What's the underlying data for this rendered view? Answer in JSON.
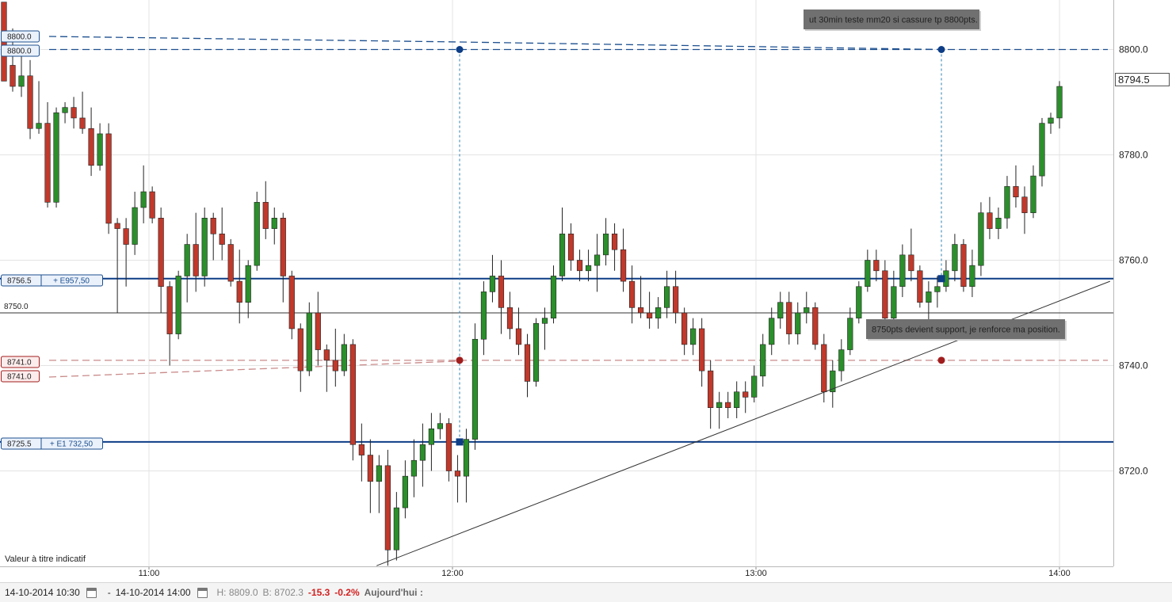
{
  "chart_data": {
    "type": "candlestick",
    "price_axis": {
      "ticks": [
        8720.0,
        8740.0,
        8760.0,
        8780.0,
        8800.0
      ],
      "tick_labels": [
        "8720.0",
        "8740.0",
        "8760.0",
        "8780.0",
        "8800.0"
      ],
      "ylim": [
        8696,
        8808
      ]
    },
    "time_axis": {
      "ticks": [
        "11:00",
        "12:00",
        "13:00",
        "14:00"
      ]
    },
    "grid": true,
    "last_price": "8794.5",
    "candles": [
      [
        8809,
        8808,
        8797,
        8794
      ],
      [
        8797,
        8804,
        8792,
        8793
      ],
      [
        8793,
        8799,
        8791,
        8795
      ],
      [
        8795,
        8798,
        8783,
        8785
      ],
      [
        8785,
        8794,
        8784,
        8786
      ],
      [
        8786,
        8790,
        8770,
        8771
      ],
      [
        8771,
        8789,
        8770,
        8788
      ],
      [
        8788,
        8790,
        8786,
        8789
      ],
      [
        8789,
        8791,
        8785,
        8787
      ],
      [
        8787,
        8792,
        8784,
        8785
      ],
      [
        8785,
        8789,
        8776,
        8778
      ],
      [
        8778,
        8786,
        8777,
        8784
      ],
      [
        8784,
        8786,
        8765,
        8767
      ],
      [
        8767,
        8768,
        8750,
        8766
      ],
      [
        8766,
        8768,
        8755,
        8763
      ],
      [
        8763,
        8773,
        8761,
        8770
      ],
      [
        8770,
        8778,
        8767,
        8773
      ],
      [
        8773,
        8774,
        8767,
        8768
      ],
      [
        8768,
        8770,
        8750,
        8755
      ],
      [
        8755,
        8756,
        8740,
        8746
      ],
      [
        8746,
        8758,
        8745,
        8757
      ],
      [
        8757,
        8765,
        8752,
        8763
      ],
      [
        8763,
        8769,
        8754,
        8757
      ],
      [
        8757,
        8770,
        8755,
        8768
      ],
      [
        8768,
        8769,
        8760,
        8765
      ],
      [
        8765,
        8770,
        8760,
        8763
      ],
      [
        8763,
        8764,
        8755,
        8756
      ],
      [
        8756,
        8762,
        8748,
        8752
      ],
      [
        8752,
        8760,
        8749,
        8759
      ],
      [
        8759,
        8773,
        8758,
        8771
      ],
      [
        8771,
        8775,
        8764,
        8766
      ],
      [
        8766,
        8770,
        8763,
        8768
      ],
      [
        8768,
        8769,
        8752,
        8757
      ],
      [
        8757,
        8758,
        8745,
        8747
      ],
      [
        8747,
        8748,
        8735,
        8739
      ],
      [
        8739,
        8752,
        8738,
        8750
      ],
      [
        8750,
        8754,
        8740,
        8743
      ],
      [
        8743,
        8744,
        8735,
        8741
      ],
      [
        8741,
        8747,
        8736,
        8739
      ],
      [
        8739,
        8746,
        8738,
        8744
      ],
      [
        8744,
        8745,
        8722,
        8725
      ],
      [
        8725,
        8729,
        8718,
        8723
      ],
      [
        8723,
        8726,
        8712,
        8718
      ],
      [
        8718,
        8723,
        8712,
        8721
      ],
      [
        8721,
        8724,
        8702,
        8705
      ],
      [
        8705,
        8716,
        8703,
        8713
      ],
      [
        8713,
        8722,
        8711,
        8719
      ],
      [
        8719,
        8726,
        8715,
        8722
      ],
      [
        8722,
        8729,
        8717,
        8725
      ],
      [
        8725,
        8731,
        8720,
        8728
      ],
      [
        8728,
        8731,
        8726,
        8729
      ],
      [
        8729,
        8730,
        8718,
        8720
      ],
      [
        8720,
        8723,
        8714,
        8719
      ],
      [
        8719,
        8728,
        8714,
        8726
      ],
      [
        8726,
        8748,
        8724,
        8745
      ],
      [
        8745,
        8756,
        8742,
        8754
      ],
      [
        8754,
        8761,
        8752,
        8757
      ],
      [
        8757,
        8760,
        8746,
        8751
      ],
      [
        8751,
        8754,
        8745,
        8747
      ],
      [
        8747,
        8751,
        8742,
        8744
      ],
      [
        8744,
        8746,
        8734,
        8737
      ],
      [
        8737,
        8749,
        8736,
        8748
      ],
      [
        8748,
        8751,
        8743,
        8749
      ],
      [
        8749,
        8759,
        8748,
        8757
      ],
      [
        8757,
        8770,
        8756,
        8765
      ],
      [
        8765,
        8767,
        8758,
        8760
      ],
      [
        8760,
        8762,
        8756,
        8758
      ],
      [
        8758,
        8762,
        8756,
        8759
      ],
      [
        8759,
        8765,
        8754,
        8761
      ],
      [
        8761,
        8768,
        8759,
        8765
      ],
      [
        8765,
        8767,
        8758,
        8762
      ],
      [
        8762,
        8766,
        8754,
        8756
      ],
      [
        8756,
        8759,
        8748,
        8751
      ],
      [
        8751,
        8757,
        8749,
        8750
      ],
      [
        8750,
        8754,
        8747,
        8749
      ],
      [
        8749,
        8753,
        8747,
        8751
      ],
      [
        8751,
        8758,
        8749,
        8755
      ],
      [
        8755,
        8758,
        8748,
        8750
      ],
      [
        8750,
        8751,
        8742,
        8744
      ],
      [
        8744,
        8749,
        8742,
        8747
      ],
      [
        8747,
        8749,
        8736,
        8739
      ],
      [
        8739,
        8741,
        8728,
        8732
      ],
      [
        8732,
        8735,
        8728,
        8733
      ],
      [
        8733,
        8735,
        8730,
        8732
      ],
      [
        8732,
        8737,
        8730,
        8735
      ],
      [
        8735,
        8737,
        8731,
        8734
      ],
      [
        8734,
        8740,
        8733,
        8738
      ],
      [
        8738,
        8746,
        8736,
        8744
      ],
      [
        8744,
        8751,
        8742,
        8749
      ],
      [
        8749,
        8754,
        8747,
        8752
      ],
      [
        8752,
        8754,
        8744,
        8746
      ],
      [
        8746,
        8752,
        8744,
        8750
      ],
      [
        8750,
        8754,
        8748,
        8751
      ],
      [
        8751,
        8752,
        8743,
        8744
      ],
      [
        8744,
        8746,
        8733,
        8735
      ],
      [
        8735,
        8741,
        8732,
        8739
      ],
      [
        8739,
        8745,
        8737,
        8743
      ],
      [
        8743,
        8751,
        8742,
        8749
      ],
      [
        8749,
        8756,
        8748,
        8755
      ],
      [
        8755,
        8762,
        8754,
        8760
      ],
      [
        8760,
        8762,
        8756,
        8758
      ],
      [
        8758,
        8760,
        8747,
        8749
      ],
      [
        8749,
        8758,
        8747,
        8755
      ],
      [
        8755,
        8763,
        8753,
        8761
      ],
      [
        8761,
        8766,
        8756,
        8758
      ],
      [
        8758,
        8759,
        8751,
        8752
      ],
      [
        8752,
        8756,
        8748,
        8754
      ],
      [
        8754,
        8757,
        8751,
        8755
      ],
      [
        8755,
        8760,
        8754,
        8758
      ],
      [
        8758,
        8765,
        8756,
        8763
      ],
      [
        8763,
        8764,
        8754,
        8755
      ],
      [
        8755,
        8762,
        8753,
        8759
      ],
      [
        8759,
        8771,
        8757,
        8769
      ],
      [
        8769,
        8772,
        8764,
        8766
      ],
      [
        8766,
        8770,
        8764,
        8768
      ],
      [
        8768,
        8776,
        8766,
        8774
      ],
      [
        8774,
        8778,
        8770,
        8772
      ],
      [
        8772,
        8774,
        8765,
        8769
      ],
      [
        8769,
        8778,
        8768,
        8776
      ],
      [
        8776,
        8787,
        8774,
        8786
      ],
      [
        8786,
        8788,
        8784,
        8787
      ],
      [
        8787,
        8794,
        8785,
        8793
      ]
    ],
    "levels": [
      {
        "price": "8800.0",
        "value": 8800.0,
        "style": "dashed",
        "color": "#1c4f8f"
      },
      {
        "price": "8800.0",
        "value": 8801.0,
        "style": "dashed",
        "color": "#1c4f8f"
      },
      {
        "price": "8756.5",
        "value": 8756.5,
        "label": "+ E957,50",
        "style": "solid",
        "color": "#0d3d86"
      },
      {
        "price": "8750.0",
        "value": 8750.0,
        "style": "thin",
        "color": "#333333"
      },
      {
        "price": "8741.0",
        "value": 8741.0,
        "style": "dashed",
        "color": "#c98a8a"
      },
      {
        "price": "8741.0",
        "value": 8740.0,
        "style": "dashed",
        "color": "#c98a8a"
      },
      {
        "price": "8725.5",
        "value": 8725.5,
        "label": "+ E1 732,50",
        "style": "solid",
        "color": "#0d3d86"
      }
    ],
    "annotations": [
      "ut 30min teste mm20 si cassure tp 8800pts.",
      "8750pts devient support, je renforce ma position."
    ],
    "trendline": {
      "from": [
        "11:45",
        8702
      ],
      "to": [
        "14:10",
        8756
      ]
    },
    "colors": {
      "up": "#2b8f2b",
      "down": "#c0392b",
      "level": "#0d3d86",
      "stop": "#a11d1d"
    }
  },
  "disclaimer": "Valeur à titre indicatif",
  "footer": {
    "start_date": "14-10-2014 10:30",
    "separator": "-",
    "end_date": "14-10-2014 14:00",
    "high": "H: 8809.0",
    "low": "B: 8702.3",
    "change": "-15.3",
    "change_pct": "-0.2%",
    "period": "Aujourd'hui :"
  }
}
